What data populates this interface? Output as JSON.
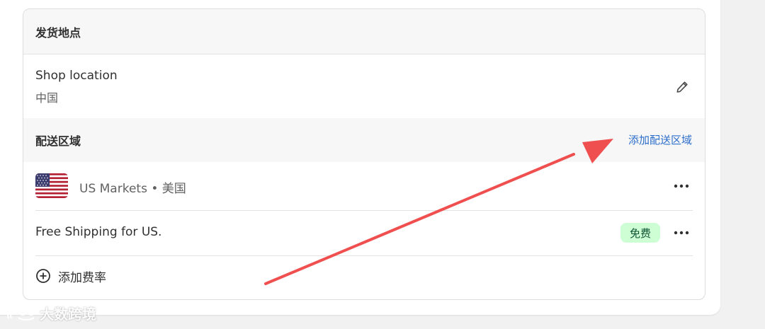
{
  "shipping_origin": {
    "title": "发货地点",
    "shop_label": "Shop location",
    "shop_value": "中国"
  },
  "zones": {
    "title": "配送区域",
    "add_zone_label": "添加配送区域",
    "market_name": "US Markets",
    "market_separator": "•",
    "market_region": "美国",
    "rate_name": "Free Shipping for US.",
    "rate_badge": "免费",
    "add_rate_label": "添加费率"
  },
  "watermark": {
    "text": "大数跨境"
  },
  "colors": {
    "link": "#2c6ecb",
    "badge_bg": "#cdfed4",
    "annotation_arrow": "#ef4f4f"
  },
  "icons": {
    "edit": "pencil-icon",
    "more": "ellipsis-icon",
    "add": "plus-circle-icon",
    "flag": "us-flag-icon"
  }
}
